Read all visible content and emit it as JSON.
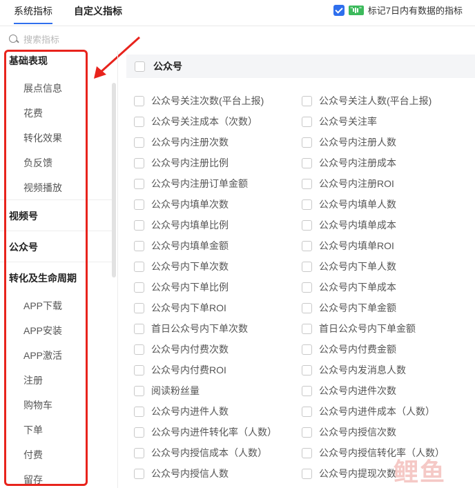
{
  "tabs": [
    {
      "label": "系统指标",
      "active": true
    },
    {
      "label": "自定义指标",
      "active": false
    }
  ],
  "mark_recent": {
    "checked": true,
    "label": "标记7日内有数据的指标"
  },
  "search": {
    "placeholder": "搜索指标"
  },
  "sidebar": {
    "groups": [
      {
        "title": "基础表现",
        "items": [
          "展点信息",
          "花费",
          "转化效果",
          "负反馈",
          "视频播放"
        ]
      },
      {
        "title": "视频号",
        "items": []
      },
      {
        "title": "公众号",
        "items": []
      },
      {
        "title": "转化及生命周期",
        "items": [
          "APP下载",
          "APP安装",
          "APP激活",
          "注册",
          "购物车",
          "下单",
          "付费",
          "留存"
        ]
      }
    ]
  },
  "panel": {
    "title": "公众号"
  },
  "metrics_left": [
    "公众号关注次数(平台上报)",
    "公众号关注成本（次数）",
    "公众号内注册次数",
    "公众号内注册比例",
    "公众号内注册订单金额",
    "公众号内填单次数",
    "公众号内填单比例",
    "公众号内填单金额",
    "公众号内下单次数",
    "公众号内下单比例",
    "公众号内下单ROI",
    "首日公众号内下单次数",
    "公众号内付费次数",
    "公众号内付费ROI",
    "阅读粉丝量",
    "公众号内进件人数",
    "公众号内进件转化率（人数）",
    "公众号内授信成本（人数）",
    "公众号内授信人数"
  ],
  "metrics_right": [
    "公众号关注人数(平台上报)",
    "公众号关注率",
    "公众号内注册人数",
    "公众号内注册成本",
    "公众号内注册ROI",
    "公众号内填单人数",
    "公众号内填单成本",
    "公众号内填单ROI",
    "公众号内下单人数",
    "公众号内下单成本",
    "公众号内下单金额",
    "首日公众号内下单金额",
    "公众号内付费金额",
    "公众号内发消息人数",
    "公众号内进件次数",
    "公众号内进件成本（人数）",
    "公众号内授信次数",
    "公众号内授信转化率（人数）",
    "公众号内提现次数"
  ],
  "watermark": "鲤鱼",
  "colors": {
    "accent": "#2f6fed",
    "highlight": "#e8231c",
    "badge": "#3cba5c"
  }
}
